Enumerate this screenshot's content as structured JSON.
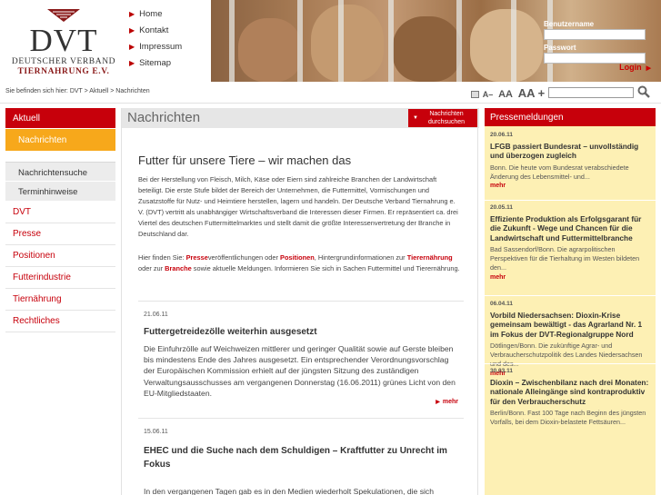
{
  "logo": {
    "name": "DVT",
    "line1": "DEUTSCHER VERBAND",
    "line2": "TIERNAHRUNG E.V."
  },
  "topnav": [
    "Home",
    "Kontakt",
    "Impressum",
    "Sitemap"
  ],
  "login": {
    "username_label": "Benutzername",
    "password_label": "Passwort",
    "button": "Login"
  },
  "breadcrumb": "Sie befinden sich hier: DVT > Aktuell > Nachrichten",
  "fontsize": {
    "small": "A",
    "small_sign": "–",
    "mid": "AA",
    "large": "AA",
    "large_sign": "+"
  },
  "sidebar": {
    "head": "Aktuell",
    "selected": "Nachrichten",
    "sub": [
      "Nachrichtensuche",
      "Terminhinweise"
    ],
    "main": [
      "DVT",
      "Presse",
      "Positionen",
      "Futterindustrie",
      "Tiernährung",
      "Rechtliches"
    ]
  },
  "main": {
    "title": "Nachrichten",
    "dropdown_line1": "Nachrichten",
    "dropdown_line2": "durchsuchen",
    "intro_title": "Futter für unsere Tiere – wir machen das",
    "intro_text": "Bei der Herstellung von Fleisch, Milch, Käse oder Eiern sind zahlreiche Branchen der Landwirtschaft beteiligt. Die erste Stufe bildet der Bereich der Unternehmen, die Futtermittel, Vormischungen und Zusatzstoffe für Nutz- und Heimtiere herstellen, lagern und handeln. Der Deutsche Verband Tiernahrung e. V. (DVT) vertritt als unabhängiger Wirtschaftsverband die Interessen dieser Firmen. Er repräsentiert ca. drei Viertel des deutschen Futtermittelmarktes und stellt damit die größte Interessenvertretung der Branche in Deutschland dar.",
    "intro2": {
      "p1": "Hier finden Sie: ",
      "l1": "Presse",
      "p2": "veröffentlichungen oder ",
      "l2": "Positionen",
      "p3": ", Hintergrundinformationen zur ",
      "l3": "Tierernährung",
      "p4": " oder zur ",
      "l4": "Branche",
      "p5": " sowie aktuelle Meldungen. Informieren Sie sich in Sachen Futtermittel und Tierernährung."
    },
    "articles": [
      {
        "date": "21.06.11",
        "title": "Futtergetreidezölle weiterhin ausgesetzt",
        "text": "Die Einfuhrzölle auf Weichweizen mittlerer und geringer Qualität sowie auf Gerste bleiben bis mindestens Ende des Jahres ausgesetzt. Ein entsprechender Verordnungsvorschlag der Europäischen Kommission erhielt auf der jüngsten Sitzung des zuständigen Verwaltungsausschusses am vergangenen Donnerstag (16.06.2011) grünes Licht von den EU-Mitgliedstaaten.",
        "more": "mehr"
      },
      {
        "date": "15.06.11",
        "title": "EHEC und die Suche nach dem Schuldigen – Kraftfutter zu Unrecht im Fokus",
        "text": "In den vergangenen Tagen gab es in den Medien wiederholt Spekulationen, die sich",
        "more": "mehr"
      }
    ]
  },
  "press": {
    "head": "Pressemeldungen",
    "items": [
      {
        "date": "20.06.11",
        "title": "LFGB passiert Bundesrat – unvollständig und überzogen zugleich",
        "text": "Bonn. Die heute vom Bundesrat verabschiedete Änderung des Lebensmittel- und...",
        "more": "mehr"
      },
      {
        "date": "20.05.11",
        "title": "Effiziente Produktion als Erfolgsgarant für die Zukunft - Wege und Chancen für die Landwirtschaft und Futtermittelbranche",
        "text": "Bad Sassendorf/Bonn. Die agrarpolitischen Perspektiven für die Tierhaltung im Westen bildeten den...",
        "more": "mehr"
      },
      {
        "date": "06.04.11",
        "title": "Vorbild Niedersachsen: Dioxin-Krise gemeinsam bewältigt - das Agrarland Nr. 1 im Fokus der DVT-Regionalgruppe Nord",
        "text": "Dötlingen/Bonn. Die zukünftige Agrar- und Verbraucherschutzpolitik des Landes Niedersachsen und des...",
        "more": "mehr"
      },
      {
        "date": "30.03.11",
        "title": "Dioxin – Zwischenbilanz nach drei Monaten: nationale Alleingänge sind kontraproduktiv für den Verbraucherschutz",
        "text": "Berlin/Bonn. Fast 100 Tage nach Beginn des jüngsten Vorfalls, bei dem Dioxin-belastete Fettsäuren...",
        "more": ""
      }
    ]
  },
  "colors": {
    "accent_red": "#c7000b",
    "accent_orange": "#f7a81b",
    "press_bg": "#fdf0b4"
  }
}
